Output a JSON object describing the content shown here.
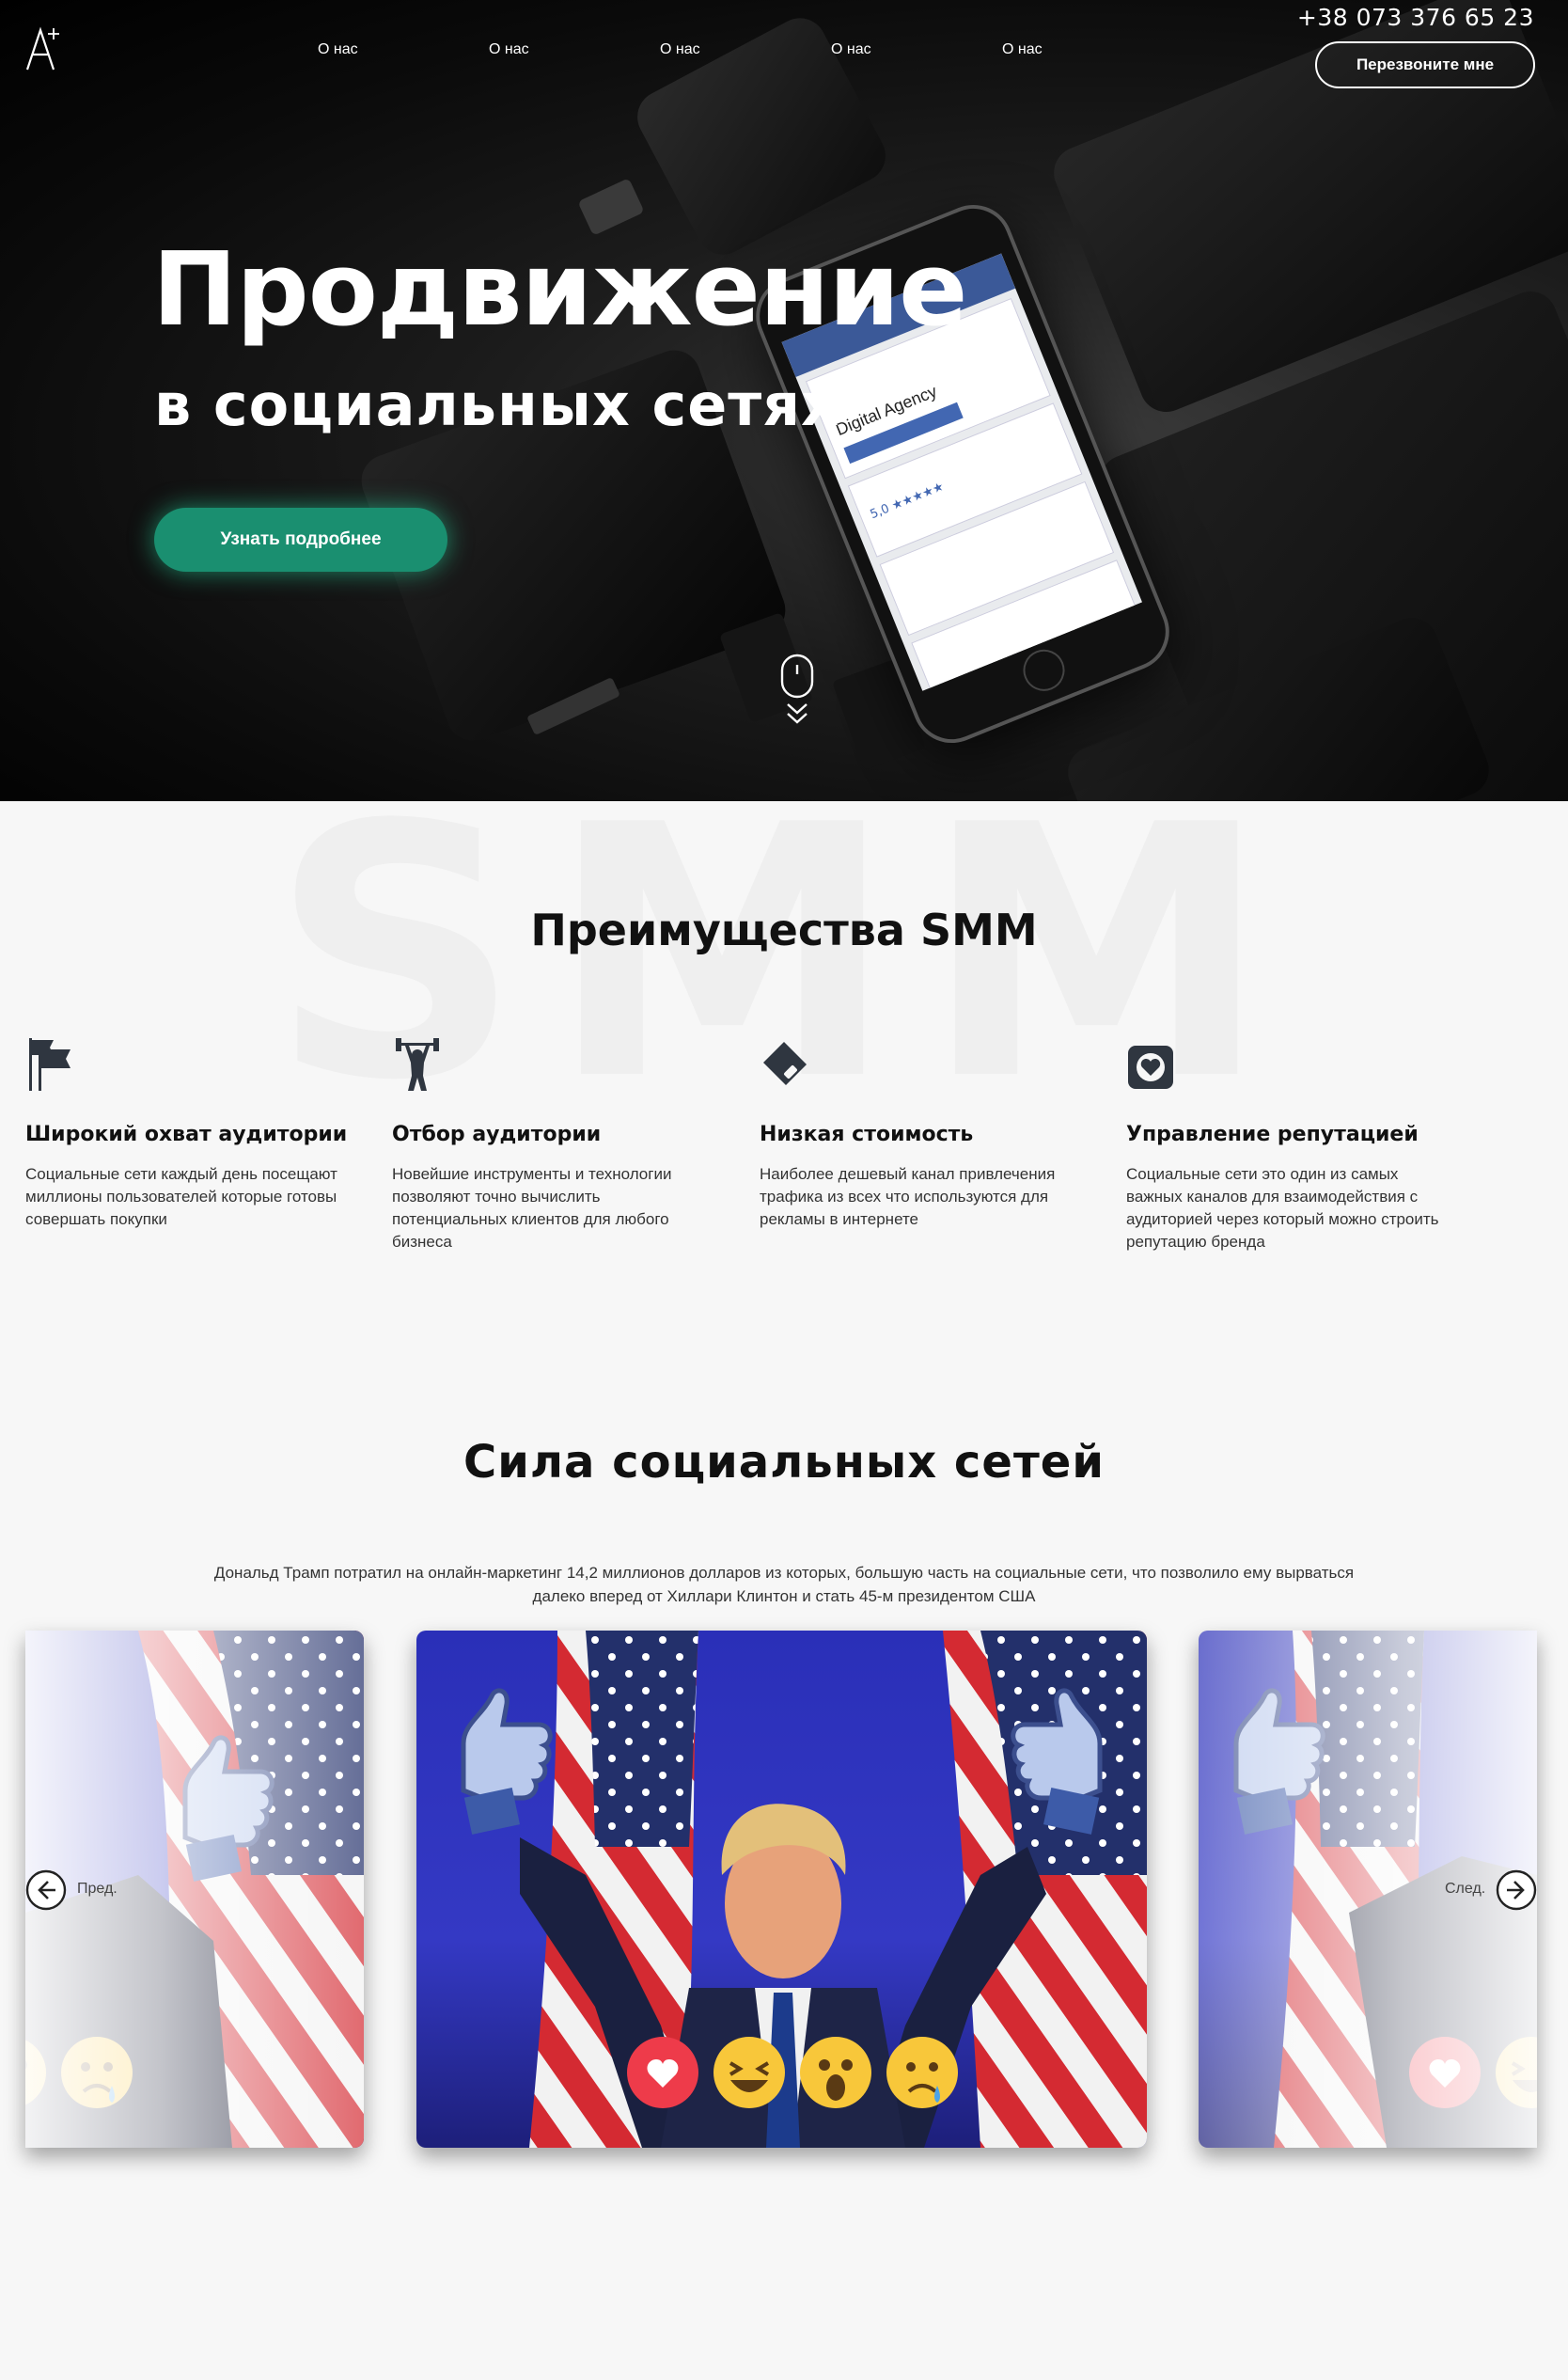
{
  "header": {
    "logo_text": "A",
    "logo_sup": "+",
    "nav": [
      {
        "label": "О нас"
      },
      {
        "label": "О нас"
      },
      {
        "label": "О нас"
      },
      {
        "label": "О нас"
      },
      {
        "label": "О нас"
      }
    ],
    "phone": "+38 073 376 65 23",
    "callback_label": "Перезвоните мне"
  },
  "hero": {
    "title": "Продвижение",
    "subtitle": "в социальных сетях",
    "cta_label": "Узнать подробнее",
    "phone_screen": {
      "heading": "Digital Agency",
      "rating": "5,0 ★★★★★"
    }
  },
  "advantages": {
    "watermark": "SMM",
    "title": "Преимущества SMM",
    "items": [
      {
        "icon": "flags-icon",
        "title": "Широкий охват аудитории",
        "text": "Социальные сети каждый день посещают миллионы пользователей которые готовы совершать покупки"
      },
      {
        "icon": "weightlifter-icon",
        "title": "Отбор аудитории",
        "text": "Новейшие инструменты и технологии позволяют точно вычислить потенциальных клиентов для любого бизнеса"
      },
      {
        "icon": "wallet-icon",
        "title": "Низкая стоимость",
        "text": "Наиболее дешевый канал привлечения трафика из всех что используются для рекламы в интернете"
      },
      {
        "icon": "heart-badge-icon",
        "title": "Управление репутацией",
        "text": "Социальные сети это один из самых важных каналов для взаимодействия с аудиторией через который можно строить репутацию бренда"
      }
    ]
  },
  "power": {
    "title": "Сила социальных сетей",
    "description": "Дональд Трамп потратил на онлайн-маркетинг 14,2 миллионов долларов из которых, большую часть на социальные сети, что позволило ему вырваться далеко вперед от Хиллари Клинтон и стать 45-м президентом США",
    "prev_label": "Пред.",
    "next_label": "След."
  },
  "colors": {
    "accent": "#1a8f70",
    "icon": "#2f3640"
  }
}
